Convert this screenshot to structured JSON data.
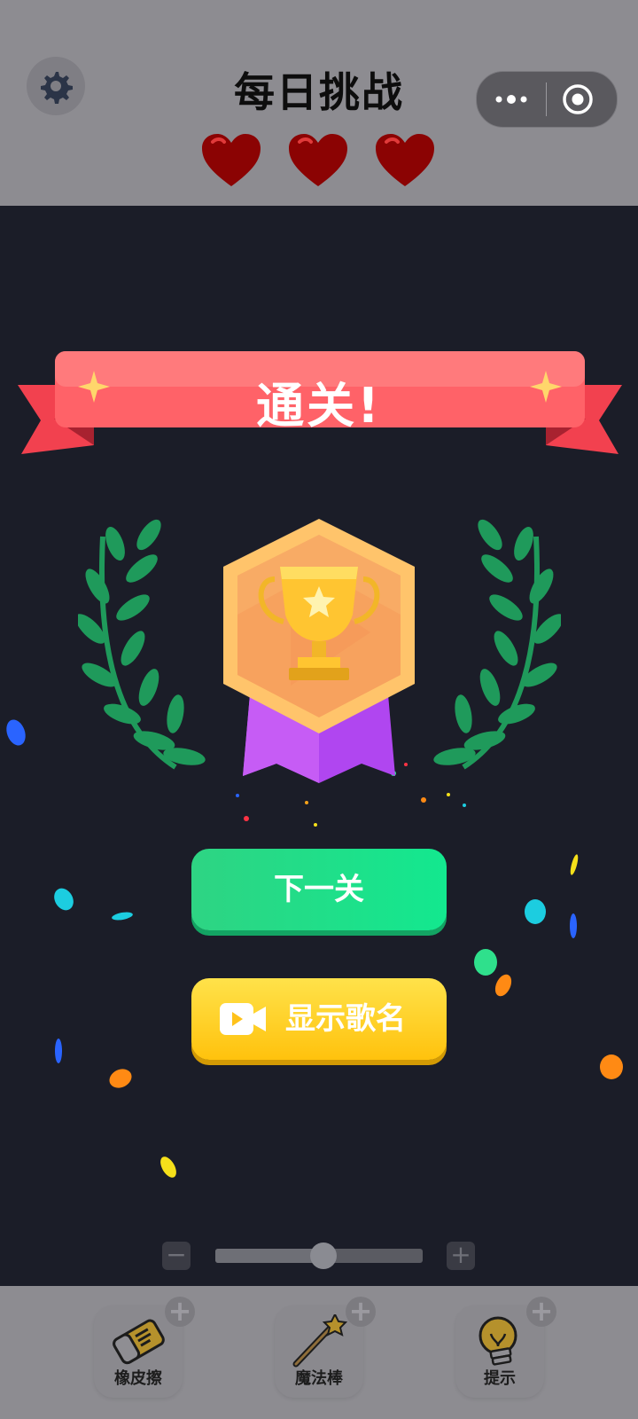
{
  "header": {
    "title": "每日挑战",
    "lives": 3,
    "settings_icon": "gear-icon",
    "more_icon": "more-dots-icon",
    "close_icon": "target-close-icon"
  },
  "result": {
    "banner_text": "通关!",
    "badge_icon": "trophy-icon"
  },
  "actions": {
    "next_label": "下一关",
    "show_song_label": "显示歌名",
    "show_song_icon": "video-camera-icon"
  },
  "slider": {
    "value": 0.52,
    "minus_label": "−",
    "plus_label": "+"
  },
  "tools": [
    {
      "label": "橡皮擦",
      "icon": "eraser-icon"
    },
    {
      "label": "魔法棒",
      "icon": "magic-wand-icon"
    },
    {
      "label": "提示",
      "icon": "lightbulb-icon"
    }
  ],
  "colors": {
    "background": "#1b1d28",
    "header": "#8d8c91",
    "next_button": "#1fe08a",
    "song_button": "#ffd125",
    "ribbon": "#ff5d66",
    "heart": "#8b0000"
  }
}
